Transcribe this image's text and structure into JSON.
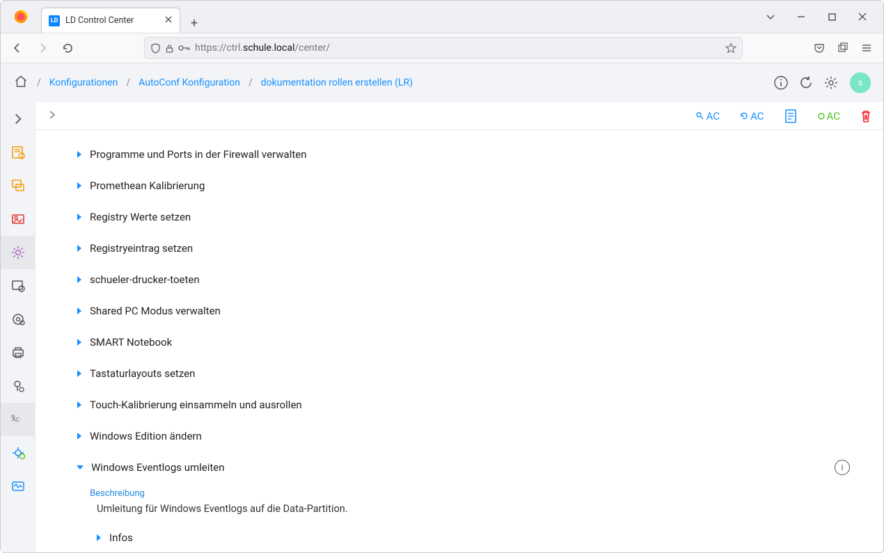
{
  "browser": {
    "tab_title": "LD Control Center",
    "favicon_text": "LD",
    "url_prefix": "https://ctrl.",
    "url_host": "schule.local",
    "url_path": "/center/"
  },
  "breadcrumb": {
    "home": "",
    "items": [
      "Konfigurationen",
      "AutoConf Konfiguration",
      "dokumentation rollen erstellen (LR)"
    ]
  },
  "avatar": "s",
  "action_labels": {
    "ac1": "AC",
    "ac2": "AC",
    "ac3": "AC"
  },
  "tree_items": [
    "Programme und Ports in der Firewall verwalten",
    "Promethean Kalibrierung",
    "Registry Werte setzen",
    "Registryeintrag setzen",
    "schueler-drucker-toeten",
    "Shared PC Modus verwalten",
    "SMART Notebook",
    "Tastaturlayouts setzen",
    "Touch-Kalibrierung einsammeln und ausrollen",
    "Windows Edition ändern"
  ],
  "expanded": {
    "title": "Windows Eventlogs umleiten",
    "section_label": "Beschreibung",
    "description": "Umleitung für Windows Eventlogs auf die Data-Partition.",
    "sub_item": "Infos"
  }
}
